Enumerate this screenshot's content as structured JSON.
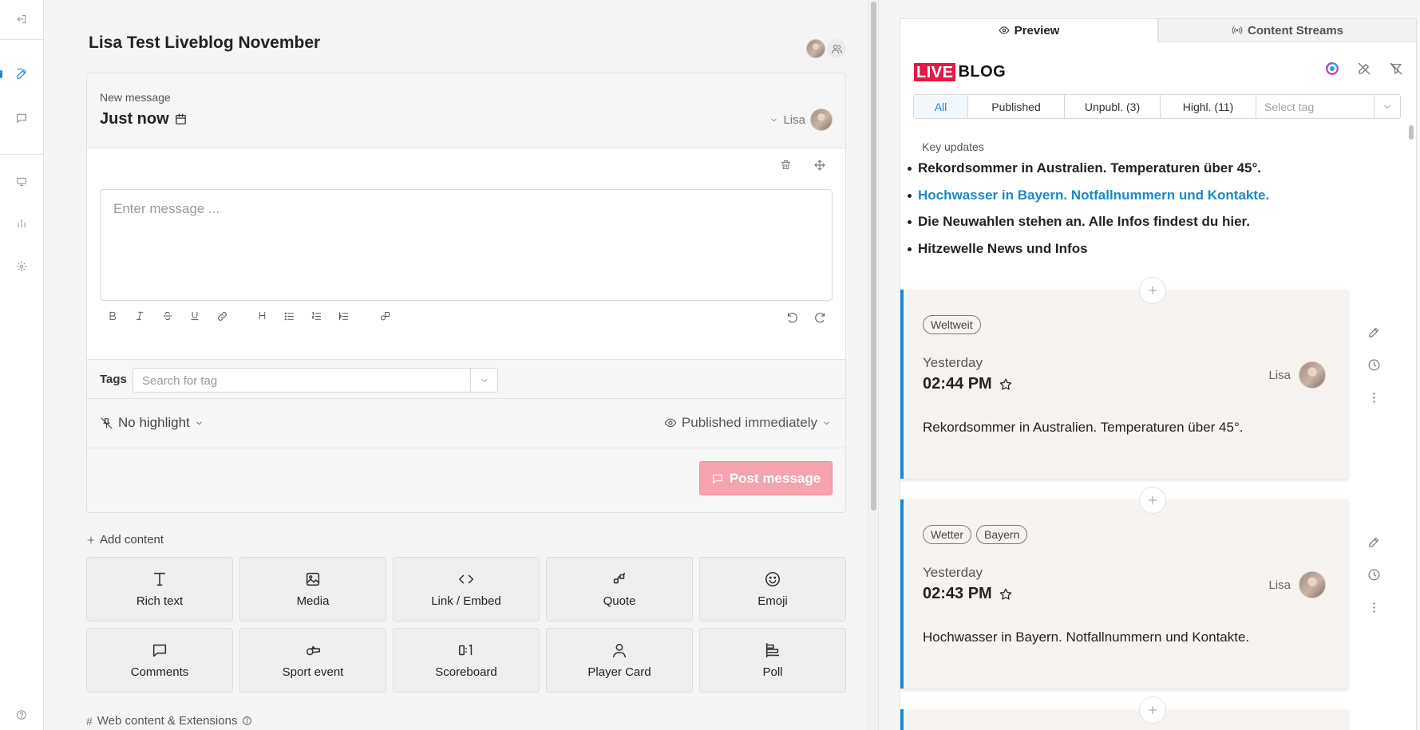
{
  "editor": {
    "title": "Lisa Test Liveblog November",
    "new_message_label": "New message",
    "time_label": "Just now",
    "author_name": "Lisa",
    "message_placeholder": "Enter message ...",
    "tags_label": "Tags",
    "tags_placeholder": "Search for tag",
    "highlight_label": "No highlight",
    "publish_label": "Published immediately",
    "post_button": "Post message",
    "add_content_label": "Add content",
    "web_content_label": "Web content & Extensions",
    "tiles": [
      {
        "label": "Rich text",
        "icon": "text-icon"
      },
      {
        "label": "Media",
        "icon": "image-icon"
      },
      {
        "label": "Link / Embed",
        "icon": "code-icon"
      },
      {
        "label": "Quote",
        "icon": "quote-icon"
      },
      {
        "label": "Emoji",
        "icon": "smiley-icon"
      },
      {
        "label": "Comments",
        "icon": "comment-icon"
      },
      {
        "label": "Sport event",
        "icon": "whistle-icon"
      },
      {
        "label": "Scoreboard",
        "icon": "scoreboard-icon"
      },
      {
        "label": "Player Card",
        "icon": "person-icon"
      },
      {
        "label": "Poll",
        "icon": "poll-icon"
      }
    ]
  },
  "preview": {
    "tabs": [
      {
        "label": "Preview",
        "icon": "eye-icon",
        "active": true
      },
      {
        "label": "Content Streams",
        "icon": "broadcast-icon",
        "active": false
      }
    ],
    "logo_live": "LIVE",
    "logo_blog": "BLOG",
    "filters": [
      {
        "label": "All",
        "active": true
      },
      {
        "label": "Published",
        "active": false
      },
      {
        "label": "Unpubl. (3)",
        "active": false
      },
      {
        "label": "Highl. (11)",
        "active": false
      }
    ],
    "tag_select_placeholder": "Select tag",
    "key_updates_label": "Key updates",
    "key_updates": [
      "Rekordsommer in Australien. Temperaturen über 45°.",
      "Hochwasser in Bayern. Notfallnummern und Kontakte.",
      "Die Neuwahlen stehen an. Alle Infos findest du hier.",
      "Hitzewelle News und Infos"
    ],
    "posts": [
      {
        "tags": [
          "Weltweit"
        ],
        "day": "Yesterday",
        "time": "02:44 PM",
        "author": "Lisa",
        "text": "Rekordsommer in Australien. Temperaturen über 45°."
      },
      {
        "tags": [
          "Wetter",
          "Bayern"
        ],
        "day": "Yesterday",
        "time": "02:43 PM",
        "author": "Lisa",
        "text": "Hochwasser in Bayern. Notfallnummern und Kontakte."
      }
    ]
  },
  "colors": {
    "accent_blue": "#1a8ad0",
    "brand_red": "#e21b48",
    "post_button_bg": "#f5a3ad"
  }
}
